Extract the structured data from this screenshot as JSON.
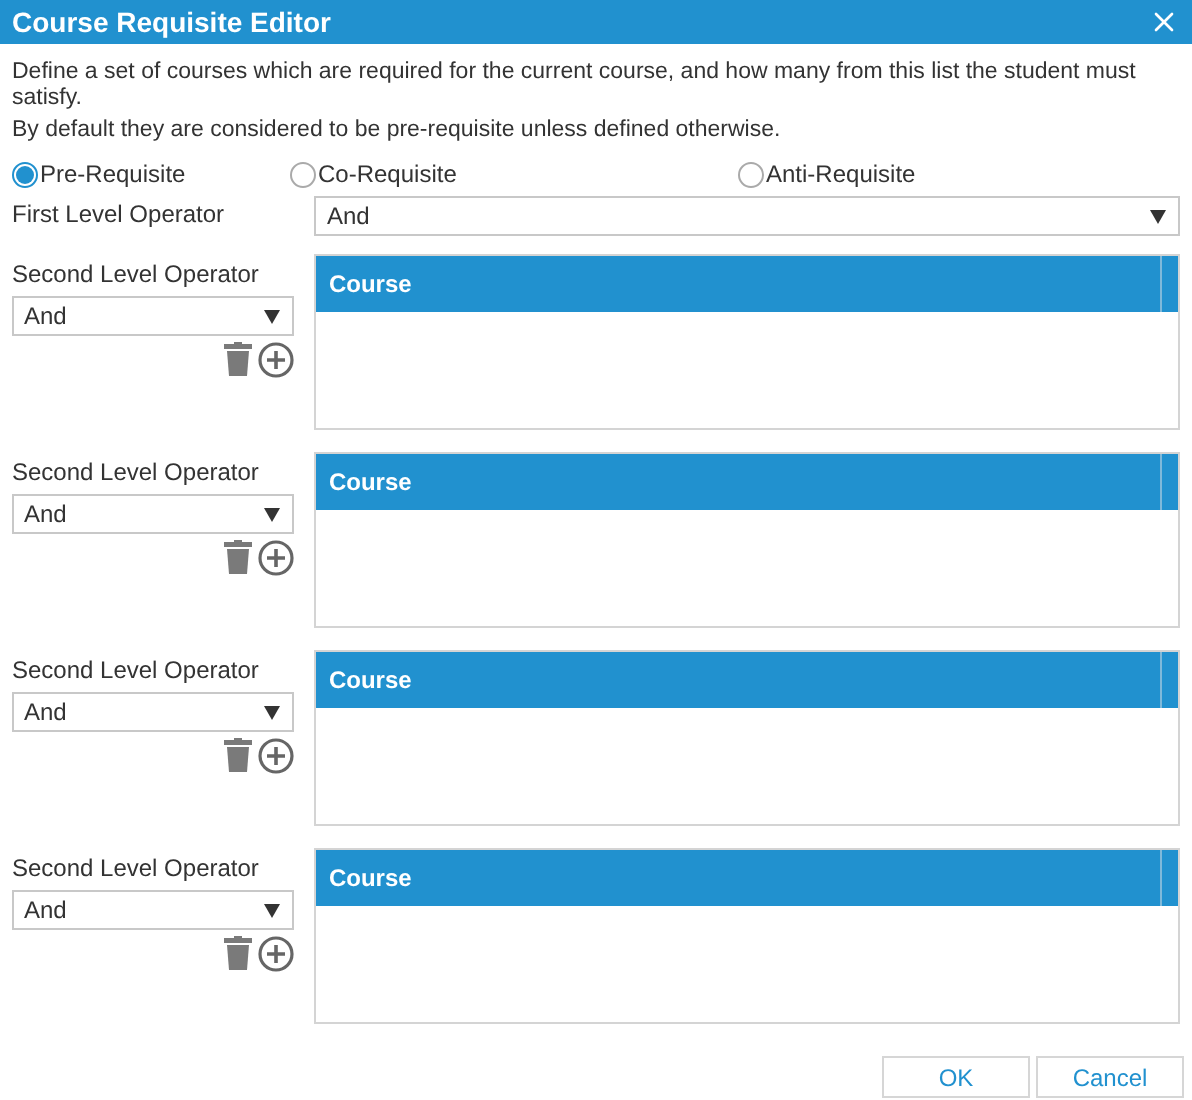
{
  "window": {
    "title": "Course Requisite Editor"
  },
  "description": [
    "Define a set of courses which are required for the current course, and how many from this list the student must satisfy.",
    "By default they are considered to be pre-requisite unless defined otherwise."
  ],
  "requisite_types": [
    {
      "label": "Pre-Requisite",
      "selected": true
    },
    {
      "label": "Co-Requisite",
      "selected": false
    },
    {
      "label": "Anti-Requisite",
      "selected": false
    }
  ],
  "first_level_operator": {
    "label": "First Level Operator",
    "value": "And"
  },
  "groups": [
    {
      "operator_label": "Second Level Operator",
      "operator_value": "And",
      "column": "Course"
    },
    {
      "operator_label": "Second Level Operator",
      "operator_value": "And",
      "column": "Course"
    },
    {
      "operator_label": "Second Level Operator",
      "operator_value": "And",
      "column": "Course"
    },
    {
      "operator_label": "Second Level Operator",
      "operator_value": "And",
      "column": "Course"
    }
  ],
  "buttons": [
    "OK",
    "Cancel"
  ]
}
